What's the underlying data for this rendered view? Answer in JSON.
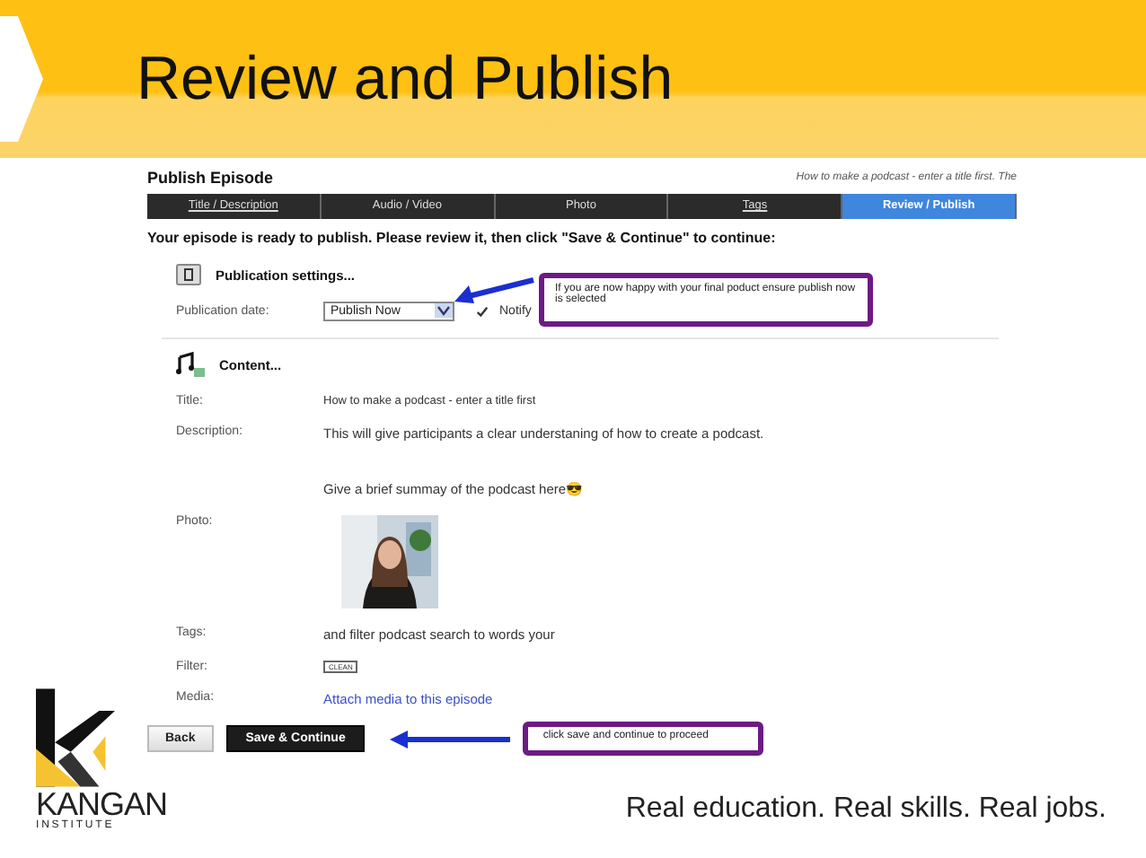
{
  "slide_title": "Review and Publish",
  "page": {
    "title": "Publish Episode",
    "episode_hint": "How to make a podcast - enter a title first. The"
  },
  "steps": [
    {
      "label": "Title / Description",
      "selected": false,
      "link": true
    },
    {
      "label": "Audio / Video",
      "selected": false,
      "link": false
    },
    {
      "label": "Photo",
      "selected": false,
      "link": false
    },
    {
      "label": "Tags",
      "selected": false,
      "link": true
    },
    {
      "label": "Review / Publish",
      "selected": true,
      "link": false
    }
  ],
  "ready_message": "Your episode is ready to publish.  Please review it, then click \"Save & Continue\" to continue:",
  "publication": {
    "heading": "Publication settings...",
    "date_label": "Publication date:",
    "date_value": "Publish Now",
    "notify_checked": true,
    "notify_label": "Notify"
  },
  "content": {
    "heading": "Content...",
    "rows": [
      {
        "kind": "text",
        "label": "Title:",
        "value": "How to make a podcast - enter a title first"
      },
      {
        "kind": "description",
        "label": "Description:",
        "lines": [
          "This will give participants a clear understaning of how to create a podcast.",
          "Give a brief summay of the podcast here😎"
        ]
      },
      {
        "label": "Photo:"
      },
      {
        "kind": "text",
        "label": "Tags:",
        "value": "and filter podcast search to words your"
      },
      {
        "kind": "select",
        "label": "Filter:",
        "value": "CLEAN"
      },
      {
        "kind": "link",
        "label": "Media:",
        "value": "Attach media to this episode"
      }
    ]
  },
  "buttons": [
    {
      "label": "Back",
      "kind": "secondary"
    },
    {
      "label": "Save & Continue",
      "kind": "primary"
    }
  ],
  "callouts": [
    {
      "text": "If you are now happy with your final poduct ensure publish now is selected"
    },
    {
      "text": "click save and continue to proceed"
    }
  ],
  "logo": {
    "name": "KANGAN",
    "sub": "INSTITUTE"
  },
  "tagline": "Real education. Real skills. Real jobs."
}
